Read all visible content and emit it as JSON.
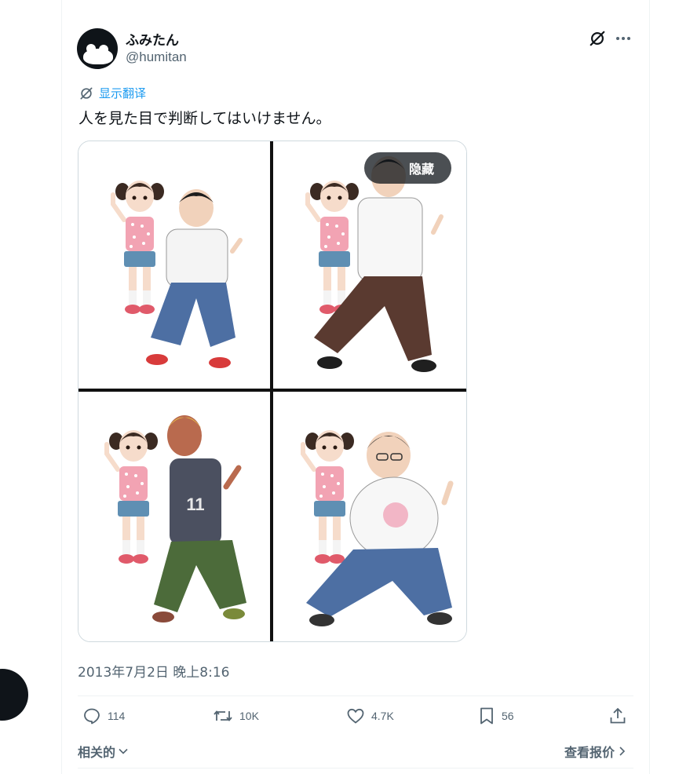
{
  "author": {
    "display_name": "ふみたん",
    "handle": "@humitan"
  },
  "translate": {
    "label": "显示翻译"
  },
  "tweet": {
    "text": "人を見た目で判断してはいけません。",
    "timestamp": "2013年7月2日 晚上8:16"
  },
  "media": {
    "hide_label": "隐藏",
    "panel_shirt_number": "11"
  },
  "actions": {
    "replies": "114",
    "reposts": "10K",
    "likes": "4.7K",
    "bookmarks": "56"
  },
  "footer": {
    "related_label": "相关的",
    "quotes_label": "查看报价"
  },
  "icons": {
    "grok": "grok-icon",
    "more": "more-icon",
    "translate": "translate-icon",
    "reply": "reply-icon",
    "repost": "repost-icon",
    "like": "heart-icon",
    "bookmark": "bookmark-icon",
    "share": "share-icon"
  },
  "colors": {
    "accent": "#1d9bf0",
    "secondary_text": "#536471",
    "primary_text": "#0f1419",
    "border": "#cfd9de"
  }
}
